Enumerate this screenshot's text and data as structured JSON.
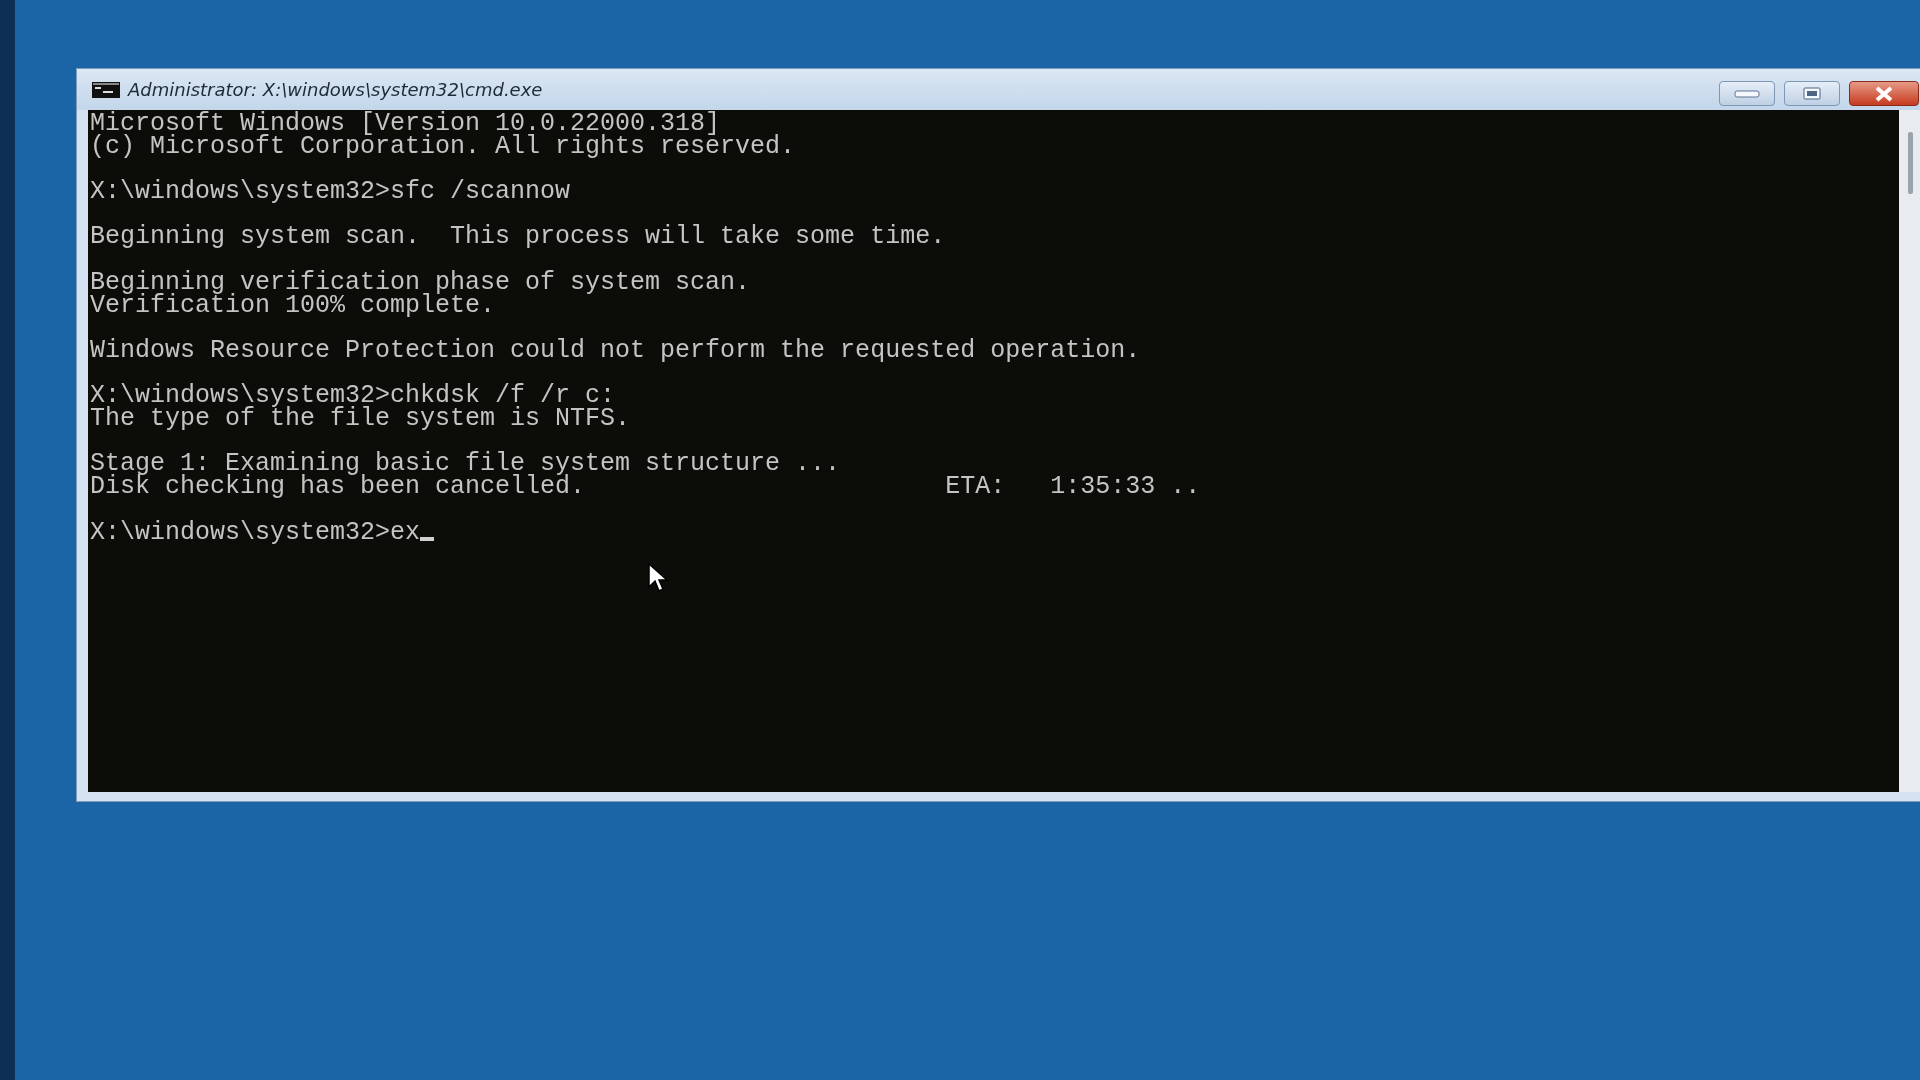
{
  "window": {
    "title": "Administrator: X:\\windows\\system32\\cmd.exe"
  },
  "console": {
    "blocks": [
      [
        "Microsoft Windows [Version 10.0.22000.318]",
        "(c) Microsoft Corporation. All rights reserved."
      ],
      [
        "X:\\windows\\system32>sfc /scannow"
      ],
      [
        "Beginning system scan.  This process will take some time."
      ],
      [
        "Beginning verification phase of system scan.",
        "Verification 100% complete."
      ],
      [
        "Windows Resource Protection could not perform the requested operation."
      ],
      [
        "X:\\windows\\system32>chkdsk /f /r c:",
        "The type of the file system is NTFS."
      ],
      [
        "Stage 1: Examining basic file system structure ...",
        "Disk checking has been cancelled.                        ETA:   1:35:33 .."
      ],
      [
        "X:\\windows\\system32>ex"
      ]
    ]
  }
}
